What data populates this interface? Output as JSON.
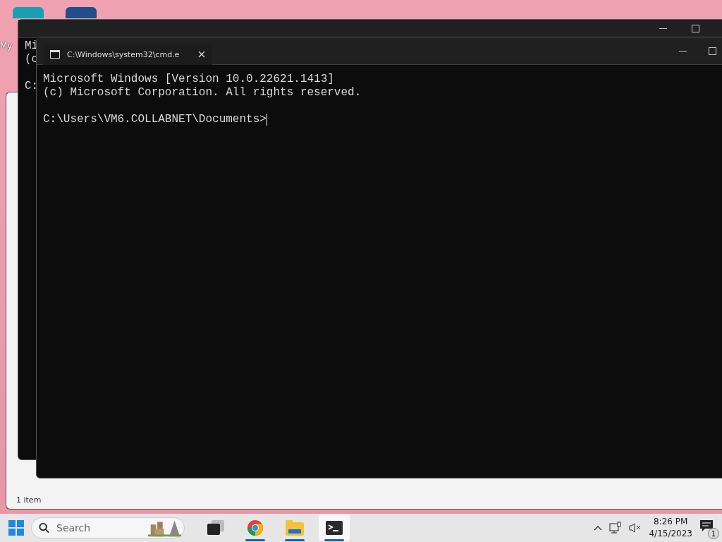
{
  "desktop": {
    "icon_label": "My"
  },
  "explorer_window": {
    "status": "1 item"
  },
  "back_console": {
    "blocks": [
      [
        "Mi",
        "(c"
      ],
      [
        "C:"
      ]
    ]
  },
  "terminal": {
    "tabs": [
      {
        "title": "C:\\Windows\\system32\\cmd.e",
        "selected": true
      }
    ],
    "blocks": [
      [
        "Microsoft Windows [Version 10.0.22621.1413]",
        "(c) Microsoft Corporation. All rights reserved."
      ],
      [
        "C:\\Users\\VM6.COLLABNET\\Documents>"
      ]
    ]
  },
  "taskbar": {
    "search": {
      "placeholder": "Search"
    },
    "apps": [
      {
        "kind": "tasks",
        "running": false,
        "selected": false
      },
      {
        "kind": "chrome",
        "running": true,
        "selected": false
      },
      {
        "kind": "folder",
        "running": true,
        "selected": false
      },
      {
        "kind": "terminal",
        "running": true,
        "selected": true
      }
    ],
    "tray": {
      "muted": true,
      "time": "8:26 PM",
      "date": "4/15/2023",
      "notifications": "1"
    }
  }
}
